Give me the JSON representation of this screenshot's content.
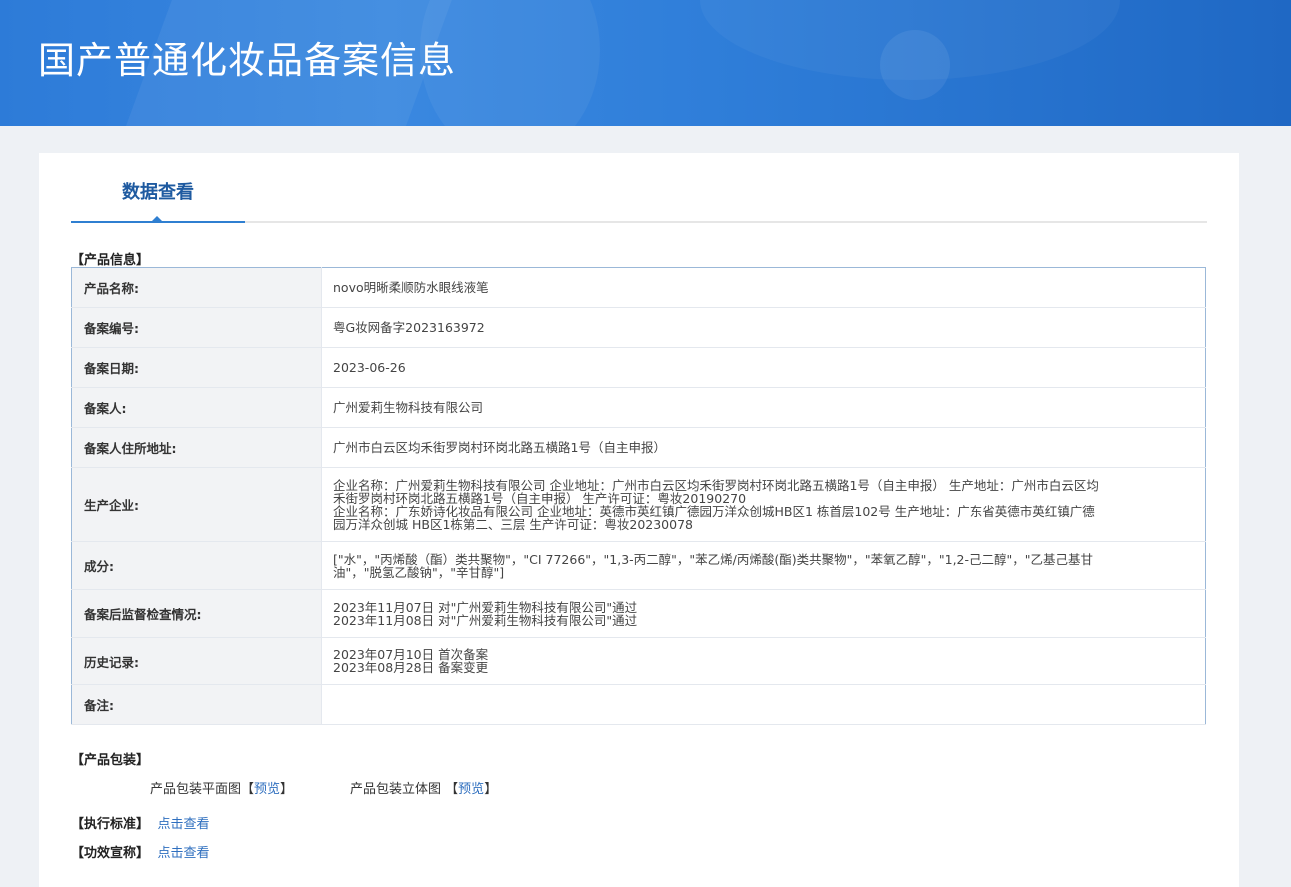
{
  "header": {
    "title": "国产普通化妆品备案信息"
  },
  "tabs": [
    {
      "label": "数据查看"
    }
  ],
  "product_info": {
    "section_title": "【产品信息】",
    "rows": [
      {
        "label": "产品名称:",
        "lines": [
          "novo明晰柔顺防水眼线液笔"
        ]
      },
      {
        "label": "备案编号:",
        "lines": [
          "粤G妆网备字2023163972"
        ]
      },
      {
        "label": "备案日期:",
        "lines": [
          "2023-06-26"
        ]
      },
      {
        "label": "备案人:",
        "lines": [
          "广州爱莉生物科技有限公司"
        ]
      },
      {
        "label": "备案人住所地址:",
        "lines": [
          "广州市白云区均禾街罗岗村环岗北路五横路1号（自主申报）"
        ]
      },
      {
        "label": "生产企业:",
        "lines": [
          "企业名称：广州爱莉生物科技有限公司 企业地址：广州市白云区均禾街罗岗村环岗北路五横路1号（自主申报） 生产地址：广州市白云区均",
          "禾街罗岗村环岗北路五横路1号（自主申报） 生产许可证：粤妆20190270",
          "企业名称：广东娇诗化妆品有限公司 企业地址：英德市英红镇广德园万洋众创城HB区1 栋首层102号 生产地址：广东省英德市英红镇广德",
          "园万洋众创城 HB区1栋第二、三层 生产许可证：粤妆20230078"
        ]
      },
      {
        "label": "成分:",
        "lines": [
          "[\"水\"，\"丙烯酸（酯）类共聚物\"，\"CI 77266\"，\"1,3-丙二醇\"，\"苯乙烯/丙烯酸(酯)类共聚物\"，\"苯氧乙醇\"，\"1,2-己二醇\"，\"乙基己基甘",
          "油\"，\"脱氢乙酸钠\"，\"辛甘醇\"]"
        ]
      },
      {
        "label": "备案后监督检查情况:",
        "lines": [
          "2023年11月07日 对\"广州爱莉生物科技有限公司\"通过",
          "2023年11月08日 对\"广州爱莉生物科技有限公司\"通过"
        ]
      },
      {
        "label": "历史记录:",
        "lines": [
          "2023年07月10日 首次备案",
          "2023年08月28日 备案变更"
        ]
      },
      {
        "label": "备注:",
        "lines": [
          ""
        ]
      }
    ]
  },
  "packaging": {
    "section_title": "【产品包装】",
    "flat_label": "产品包装平面图",
    "three_d_label": "产品包装立体图",
    "bracket_open": "【",
    "bracket_close": "】",
    "preview_link": "预览"
  },
  "standard": {
    "section_title": "【执行标准】",
    "link": "点击查看"
  },
  "efficacy": {
    "section_title": "【功效宣称】",
    "link": "点击查看"
  }
}
